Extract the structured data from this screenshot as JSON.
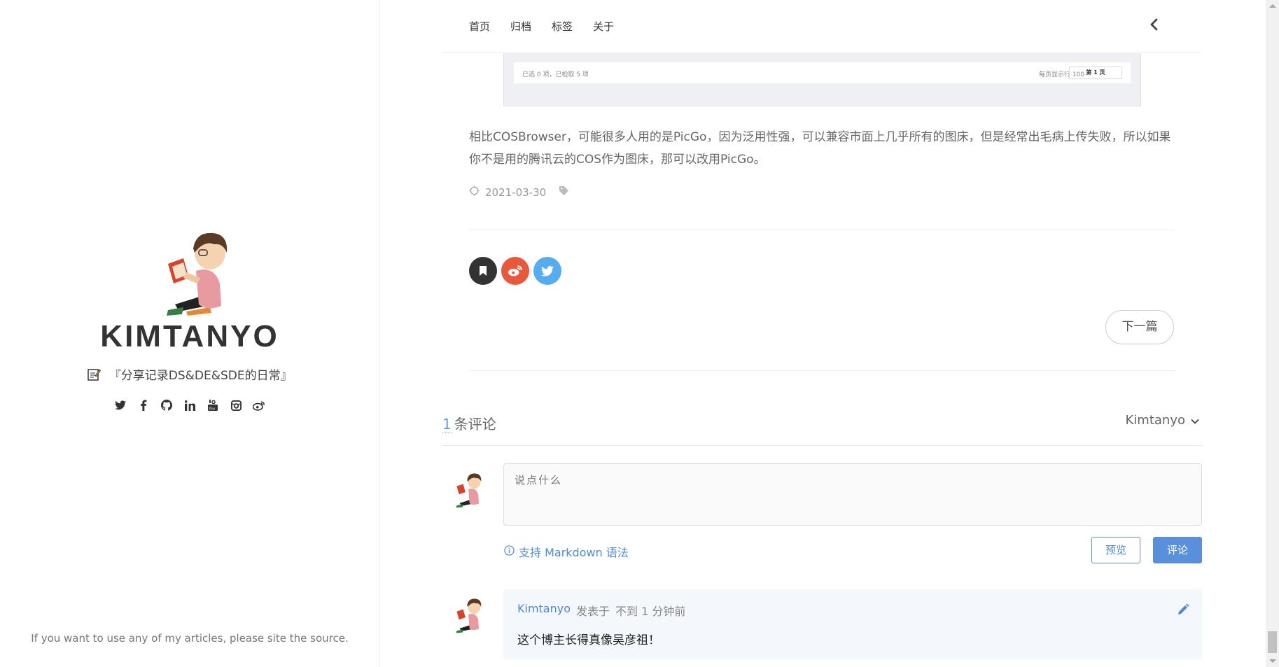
{
  "sidebar": {
    "title": "KIMTANYO",
    "tagline": "『分享记录DS&DE&SDE的日常』",
    "social_icons": [
      "twitter-icon",
      "facebook-icon",
      "github-icon",
      "linkedin-icon",
      "youtube-icon",
      "instagram-icon",
      "weibo-icon"
    ],
    "footer_note": "If you want to use any of my articles, please site the source."
  },
  "nav": {
    "items": [
      "首页",
      "归档",
      "标签",
      "关于"
    ]
  },
  "embedded_screenshot": {
    "left_text": "已选 0 项，已检取 5 项",
    "right_text": "每页显示行 100",
    "page_label": "第 1 页"
  },
  "article": {
    "text": "相比COSBrowser，可能很多人用的是PicGo，因为泛用性强，可以兼容市面上几乎所有的图床，但是经常出毛病上传失败，所以如果你不是用的腾讯云的COS作为图床，那可以改用PicGo。",
    "date": "2021-03-30"
  },
  "share": {
    "colors": {
      "bookmark": "#333333",
      "weibo": "#e8583d",
      "twitter": "#55acee"
    }
  },
  "pager": {
    "next_label": "下一篇"
  },
  "comments": {
    "count": "1",
    "count_label": "条评论",
    "current_user": "Kimtanyo",
    "placeholder": "说点什么",
    "markdown_hint": "支持 Markdown 语法",
    "preview_label": "预览",
    "submit_label": "评论",
    "items": [
      {
        "nick": "Kimtanyo",
        "posted_label": "发表于",
        "time": "不到 1 分钟前",
        "body": "这个博主长得真像吴彦祖！"
      }
    ]
  },
  "colors": {
    "accent": "#5a8fdb",
    "text": "#666666"
  }
}
